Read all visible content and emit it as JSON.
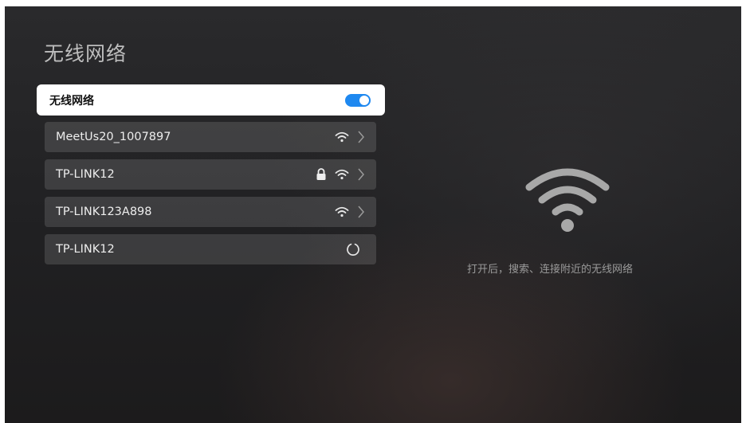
{
  "page": {
    "title": "无线网络"
  },
  "wifi_toggle": {
    "label": "无线网络",
    "state": "on",
    "accent_color": "#1e88f0"
  },
  "networks": [
    {
      "name": "MeetUs20_1007897",
      "secured": false,
      "status": "available",
      "icons": [
        "wifi-signal-icon",
        "chevron-right-icon"
      ]
    },
    {
      "name": "TP-LINK12",
      "secured": true,
      "status": "available",
      "icons": [
        "lock-icon",
        "wifi-signal-icon",
        "chevron-right-icon"
      ]
    },
    {
      "name": "TP-LINK123A898",
      "secured": false,
      "status": "available",
      "icons": [
        "wifi-signal-icon",
        "chevron-right-icon"
      ]
    },
    {
      "name": "TP-LINK12",
      "secured": false,
      "status": "connecting",
      "icons": [
        "loading-spinner-icon"
      ]
    }
  ],
  "hint": {
    "icon": "wifi-large-icon",
    "text": "打开后，搜索、连接附近的无线网络"
  }
}
